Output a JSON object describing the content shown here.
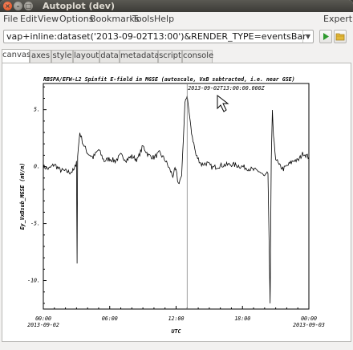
{
  "window": {
    "title": "Autoplot (dev)",
    "close_glyph": "×",
    "min_glyph": "–",
    "max_glyph": "□"
  },
  "menu": {
    "items": [
      "File",
      "Edit",
      "View",
      "Options",
      "Bookmarks",
      "Tools",
      "Help"
    ],
    "expert_label": "Expert"
  },
  "address": {
    "value": "vap+inline:dataset('2013-09-02T13:00')&RENDER_TYPE=eventsBar",
    "dropdown_glyph": "▼"
  },
  "toolbar": {
    "go_icon": "play-arrow-icon",
    "open_icon": "folder-icon",
    "go_color": "#2e9a2e"
  },
  "tabs": [
    "canvas",
    "axes",
    "style",
    "layout",
    "data",
    "metadata",
    "script",
    "console"
  ],
  "chart_data": {
    "type": "line",
    "title": "RBSPA/EFW-L2  Spinfit E-field in MGSE (autoscale, VxB subtracted, i.e. near GSE)",
    "xlabel": "UTC",
    "ylabel": "Ey_VxBsub_MGSE (mV/m)",
    "ylim": [
      -12.5,
      7.3
    ],
    "xlim_hours": [
      0,
      24
    ],
    "x_ticks": [
      "00:00",
      "06:00",
      "12:00",
      "18:00",
      "00:00"
    ],
    "x_tick_dates": [
      "2013-09-02",
      "",
      "",
      "",
      "2013-09-03"
    ],
    "y_ticks": [
      "5.",
      "0.",
      "-5.",
      "-10."
    ],
    "y_tick_values": [
      5,
      0,
      -5,
      -10
    ],
    "event_marker": {
      "label": "2013-09-02T13:00:00.000Z",
      "hour": 13
    },
    "series": [
      {
        "x": [
          0.0,
          0.5,
          1.0,
          1.5,
          2.0,
          2.4,
          2.8,
          3.0,
          3.05,
          3.1,
          3.3,
          3.6,
          4.0,
          4.5,
          5.0,
          5.5,
          6.0,
          6.5,
          7.0,
          7.5,
          8.0,
          8.5,
          9.0,
          9.5,
          10.0,
          10.5,
          11.0,
          11.5,
          11.7,
          11.9,
          12.0,
          12.2,
          12.5,
          12.8,
          13.0,
          13.4,
          13.8,
          14.3,
          14.8,
          15.3,
          16.0,
          17.0,
          18.0,
          19.0,
          19.5,
          20.0,
          20.3,
          20.5,
          20.6,
          20.7,
          20.8,
          21.0,
          21.3,
          21.7,
          22.2,
          22.7,
          23.0,
          23.5,
          24.0
        ],
        "y": [
          0.0,
          -0.2,
          0.2,
          -0.3,
          -0.4,
          -0.5,
          -0.3,
          0.5,
          -8.5,
          1.0,
          3.0,
          2.0,
          1.2,
          0.8,
          1.5,
          0.5,
          0.7,
          0.5,
          1.0,
          0.6,
          0.9,
          0.6,
          1.8,
          1.0,
          0.8,
          1.2,
          0.6,
          -0.4,
          -0.8,
          -0.3,
          -0.4,
          -1.5,
          -0.8,
          5.5,
          6.2,
          3.0,
          1.0,
          0.2,
          0.3,
          -0.1,
          0.1,
          0.2,
          0.0,
          -0.3,
          -0.4,
          -0.9,
          -0.6,
          -12.0,
          0.5,
          5.0,
          2.5,
          0.8,
          0.1,
          -0.2,
          0.2,
          0.6,
          0.5,
          1.2,
          0.8
        ]
      }
    ]
  }
}
